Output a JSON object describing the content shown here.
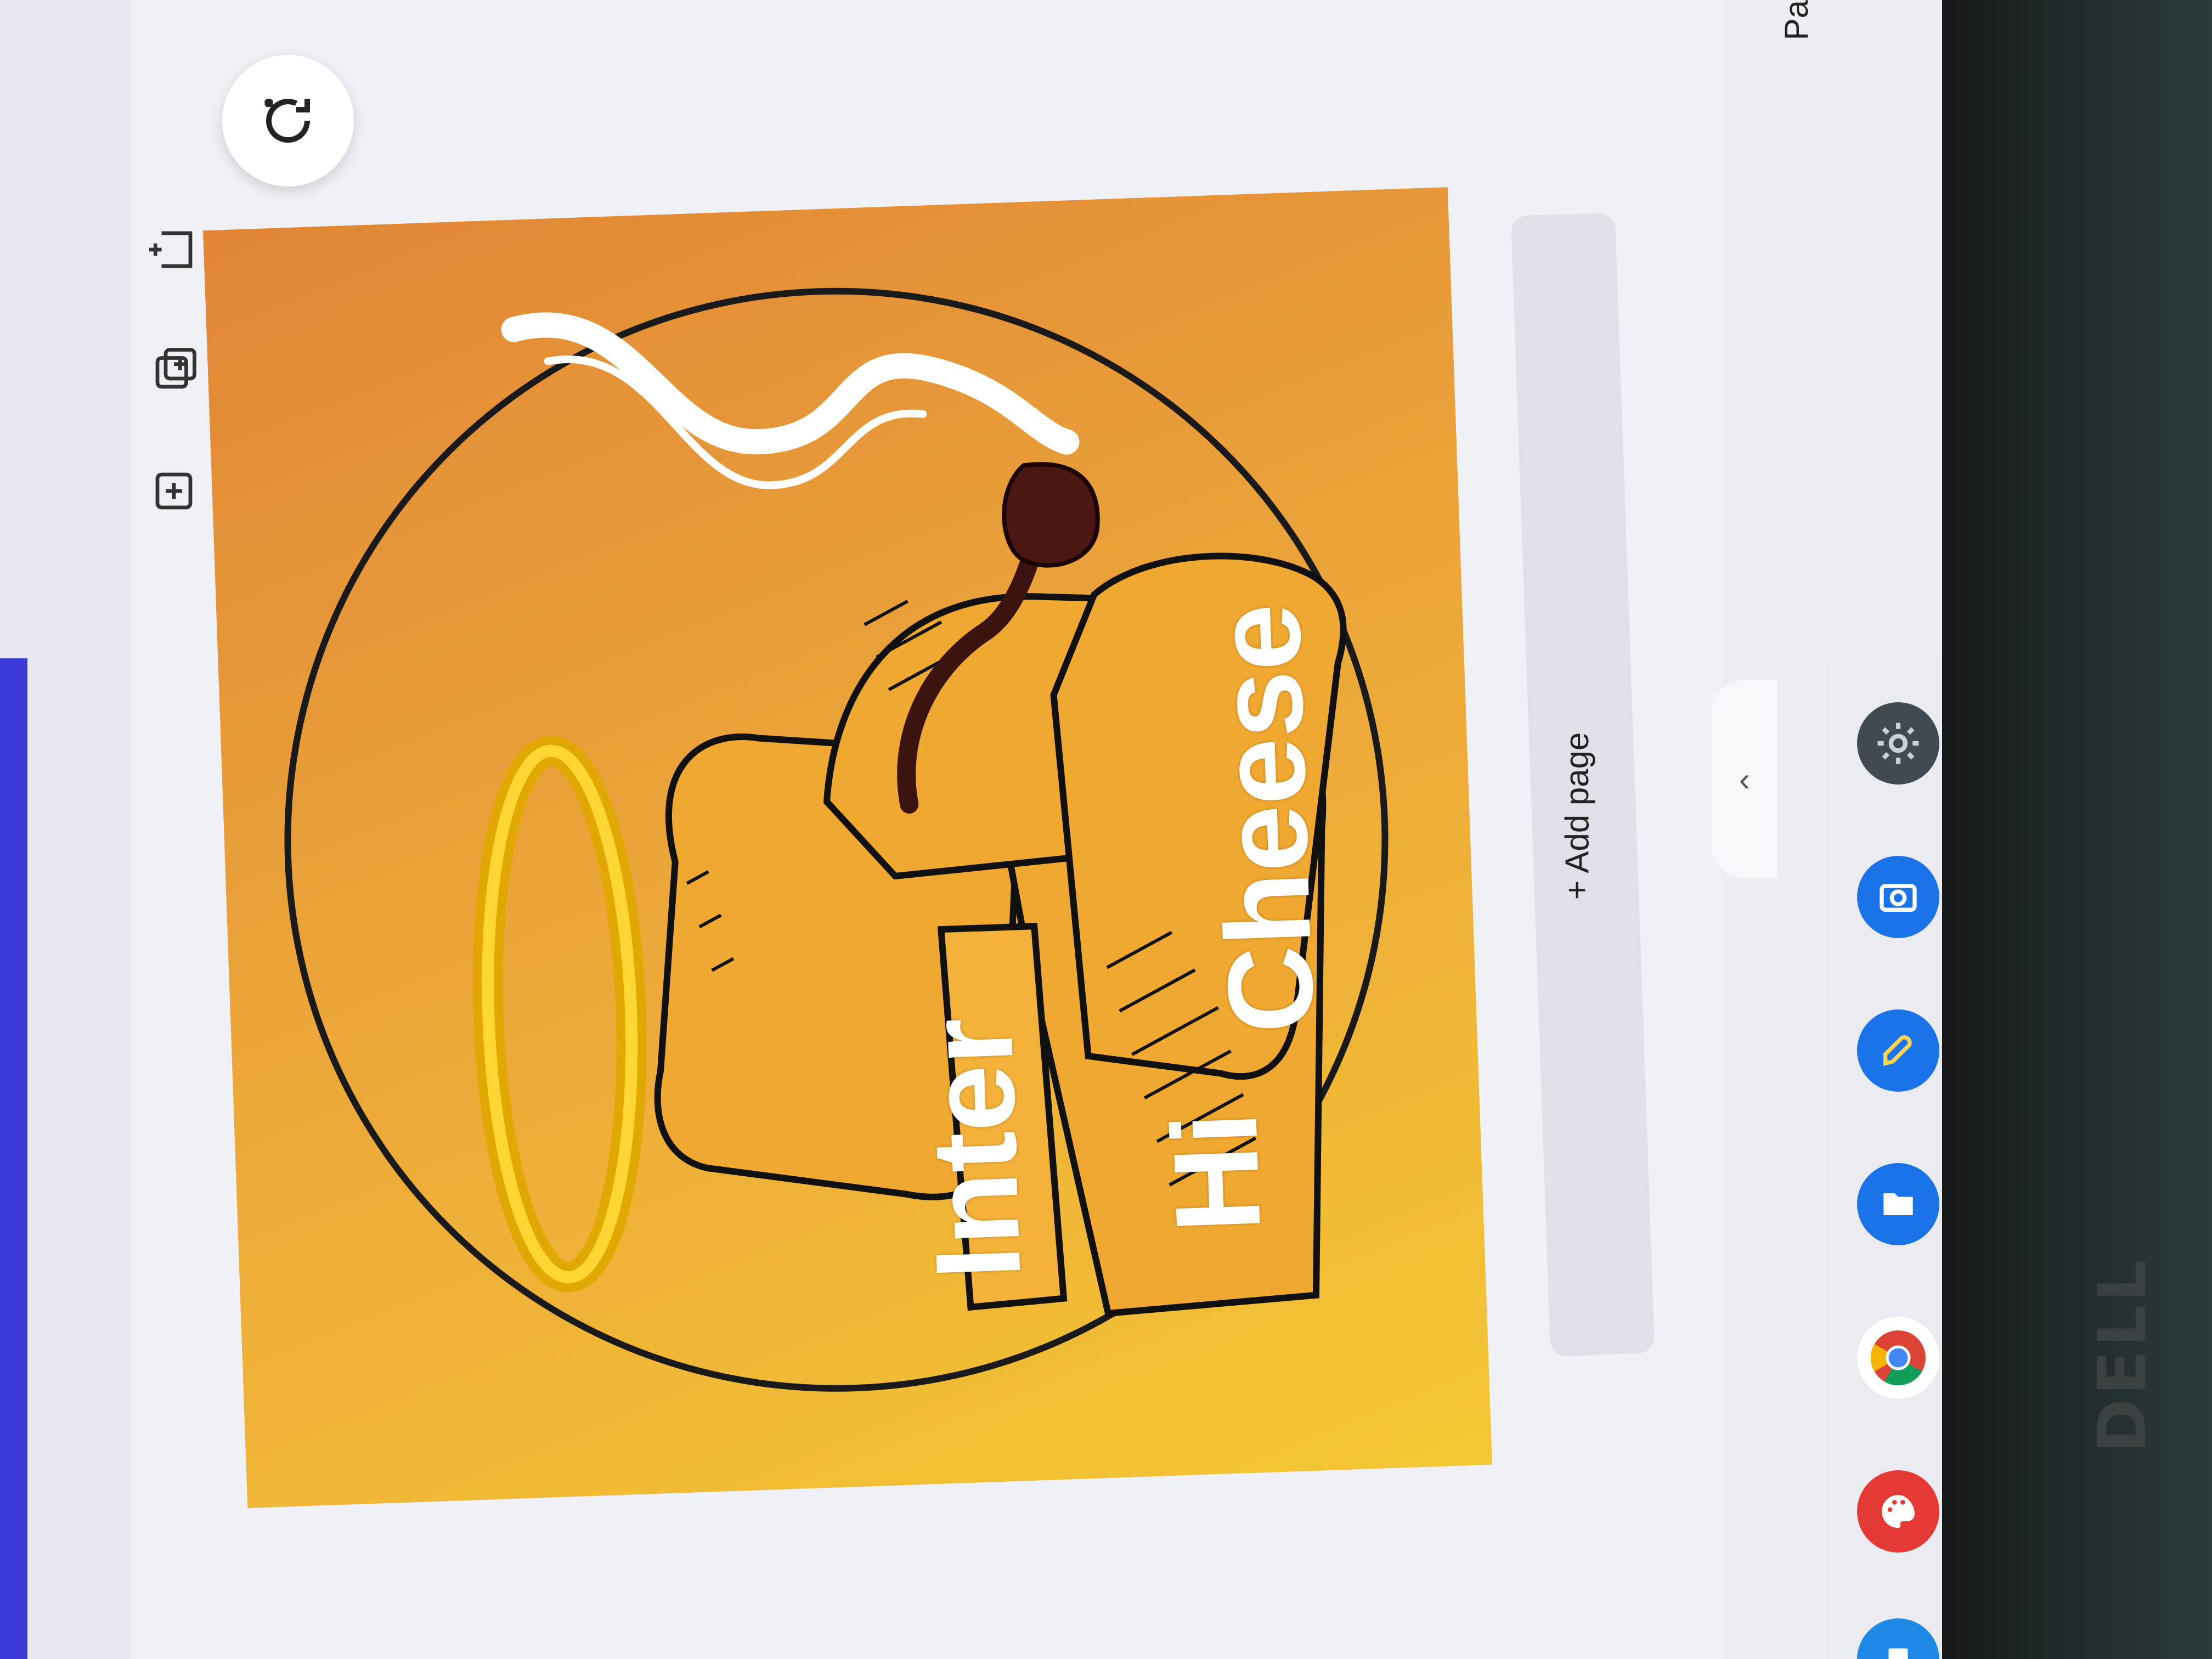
{
  "canvas": {
    "text_inter": "Inter",
    "text_hi": "Hi",
    "text_cheese": "Cheese"
  },
  "editor": {
    "add_page_label": "+ Add page",
    "collapse_glyph": "‹",
    "edge_text": "Pa"
  },
  "monitor": {
    "brand": "DELL"
  },
  "shelf": {
    "apps": [
      {
        "name": "settings-icon",
        "color": "#3f4a52"
      },
      {
        "name": "camera-icon",
        "color": "#1a73e8"
      },
      {
        "name": "rocket-app-icon",
        "color": "#1a73e8"
      },
      {
        "name": "files-icon",
        "color": "#1a73e8"
      },
      {
        "name": "chrome-icon",
        "color": "#db4437"
      },
      {
        "name": "canvas-paint-icon",
        "color": "#e53935"
      },
      {
        "name": "docs-icon",
        "color": "#1e88e5"
      }
    ]
  },
  "colors": {
    "accent": "#3a39d6",
    "gradient_top": "#e08635",
    "gradient_bottom": "#f4c733"
  }
}
